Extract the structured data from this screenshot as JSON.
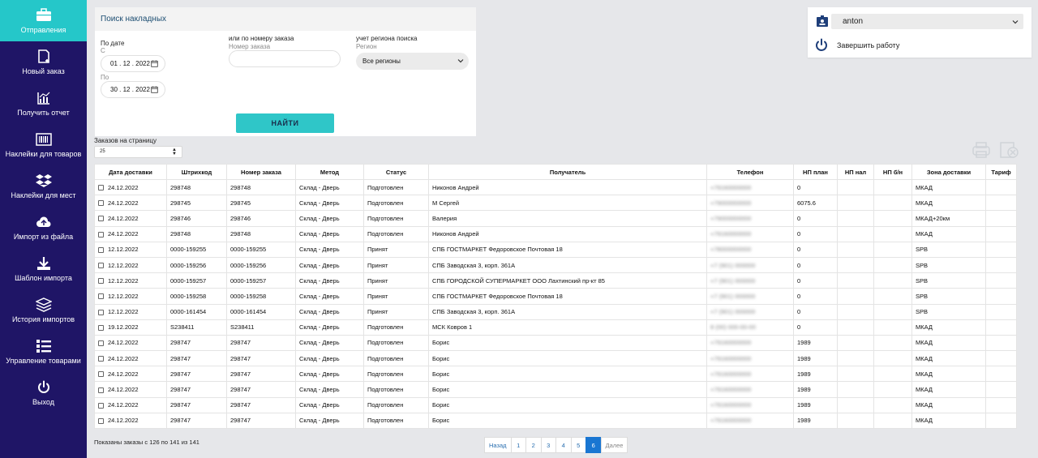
{
  "sidebar": {
    "items": [
      {
        "label": "Отправления",
        "icon": "briefcase-icon",
        "active": true
      },
      {
        "label": "Новый заказ",
        "icon": "new-order-icon"
      },
      {
        "label": "Получить отчет",
        "icon": "report-chart-icon"
      },
      {
        "label": "Наклейки для товаров",
        "icon": "barcode-icon"
      },
      {
        "label": "Наклейки для мест",
        "icon": "boxes-icon"
      },
      {
        "label": "Импорт из файла",
        "icon": "cloud-upload-icon"
      },
      {
        "label": "Шаблон импорта",
        "icon": "download-icon"
      },
      {
        "label": "История импортов",
        "icon": "layers-icon"
      },
      {
        "label": "Управление товарами",
        "icon": "list-icon"
      },
      {
        "label": "Выход",
        "icon": "power-icon"
      }
    ]
  },
  "search": {
    "title": "Поиск накладных",
    "by_date": "По дате",
    "from_label": "С",
    "from_value": "01 . 12 . 2022",
    "to_label": "По",
    "to_value": "30 . 12 . 2022",
    "order_label": "или по номеру заказа",
    "order_sublabel": "Номер заказа",
    "order_value": "",
    "region_label": "учет региона поиска",
    "region_sublabel": "Регион",
    "region_value": "Все регионы",
    "find_button": "НАЙТИ"
  },
  "per_page": {
    "label": "Заказов на страницу",
    "value": "25"
  },
  "user": {
    "name": "anton",
    "logout": "Завершить работу"
  },
  "table": {
    "headers": [
      "Дата доставки",
      "Штрихкод",
      "Номер заказа",
      "Метод",
      "Статус",
      "Получатель",
      "Телефон",
      "НП план",
      "НП нал",
      "НП б/н",
      "Зона доставки",
      "Тариф"
    ],
    "rows": [
      [
        "24.12.2022",
        "298748",
        "298748",
        "Склад - Дверь",
        "Подготовлен",
        "Никонов Андрей",
        "+79160000000",
        "0",
        "",
        "",
        "МКАД",
        ""
      ],
      [
        "24.12.2022",
        "298745",
        "298745",
        "Склад - Дверь",
        "Подготовлен",
        "М Сергей",
        "+79000000000",
        "6075.6",
        "",
        "",
        "МКАД",
        ""
      ],
      [
        "24.12.2022",
        "298746",
        "298746",
        "Склад - Дверь",
        "Подготовлен",
        "Валерия",
        "+79000000000",
        "0",
        "",
        "",
        "МКАД+20км",
        ""
      ],
      [
        "24.12.2022",
        "298748",
        "298748",
        "Склад - Дверь",
        "Подготовлен",
        "Никонов Андрей",
        "+79160000000",
        "0",
        "",
        "",
        "МКАД",
        ""
      ],
      [
        "12.12.2022",
        "0000-159255",
        "0000-159255",
        "Склад - Дверь",
        "Принят",
        "СПБ ГОСТМАРКЕТ Федоровское Почтовая 18",
        "+78000000000",
        "0",
        "",
        "",
        "SPB",
        ""
      ],
      [
        "12.12.2022",
        "0000-159256",
        "0000-159256",
        "Склад - Дверь",
        "Принят",
        "СПБ Заводская 3, корп. 361А",
        "+7 (901) 000000",
        "0",
        "",
        "",
        "SPB",
        ""
      ],
      [
        "12.12.2022",
        "0000-159257",
        "0000-159257",
        "Склад - Дверь",
        "Принят",
        "СПБ ГОРОДСКОЙ СУПЕРМАРКЕТ ООО Лахтинский пр-кт 85",
        "+7 (901) 000000",
        "0",
        "",
        "",
        "SPB",
        ""
      ],
      [
        "12.12.2022",
        "0000-159258",
        "0000-159258",
        "Склад - Дверь",
        "Принят",
        "СПБ ГОСТМАРКЕТ Федоровское Почтовая 18",
        "+7 (901) 000000",
        "0",
        "",
        "",
        "SPB",
        ""
      ],
      [
        "12.12.2022",
        "0000-161454",
        "0000-161454",
        "Склад - Дверь",
        "Принят",
        "СПБ Заводская 3, корп. 361А",
        "+7 (901) 000000",
        "0",
        "",
        "",
        "SPB",
        ""
      ],
      [
        "19.12.2022",
        "S238411",
        "S238411",
        "Склад - Дверь",
        "Подготовлен",
        "МСК Ковров 1",
        "8 (00) 000-00-00",
        "0",
        "",
        "",
        "МКАД",
        ""
      ],
      [
        "24.12.2022",
        "298747",
        "298747",
        "Склад - Дверь",
        "Подготовлен",
        "Борис",
        "+79160000000",
        "1989",
        "",
        "",
        "МКАД",
        ""
      ],
      [
        "24.12.2022",
        "298747",
        "298747",
        "Склад - Дверь",
        "Подготовлен",
        "Борис",
        "+79160000000",
        "1989",
        "",
        "",
        "МКАД",
        ""
      ],
      [
        "24.12.2022",
        "298747",
        "298747",
        "Склад - Дверь",
        "Подготовлен",
        "Борис",
        "+79160000000",
        "1989",
        "",
        "",
        "МКАД",
        ""
      ],
      [
        "24.12.2022",
        "298747",
        "298747",
        "Склад - Дверь",
        "Подготовлен",
        "Борис",
        "+79160000000",
        "1989",
        "",
        "",
        "МКАД",
        ""
      ],
      [
        "24.12.2022",
        "298747",
        "298747",
        "Склад - Дверь",
        "Подготовлен",
        "Борис",
        "+79160000000",
        "1989",
        "",
        "",
        "МКАД",
        ""
      ],
      [
        "24.12.2022",
        "298747",
        "298747",
        "Склад - Дверь",
        "Подготовлен",
        "Борис",
        "+79160000000",
        "1989",
        "",
        "",
        "МКАД",
        ""
      ]
    ]
  },
  "footer": {
    "info": "Показаны заказы с 126 по 141 из 141"
  },
  "pagination": {
    "prev": "Назад",
    "pages": [
      "1",
      "2",
      "3",
      "4",
      "5",
      "6"
    ],
    "active": "6",
    "next": "Далее"
  },
  "colors": {
    "sidebar": "#1f1566",
    "accent": "#25c7c9",
    "active_page": "#1976d2"
  }
}
